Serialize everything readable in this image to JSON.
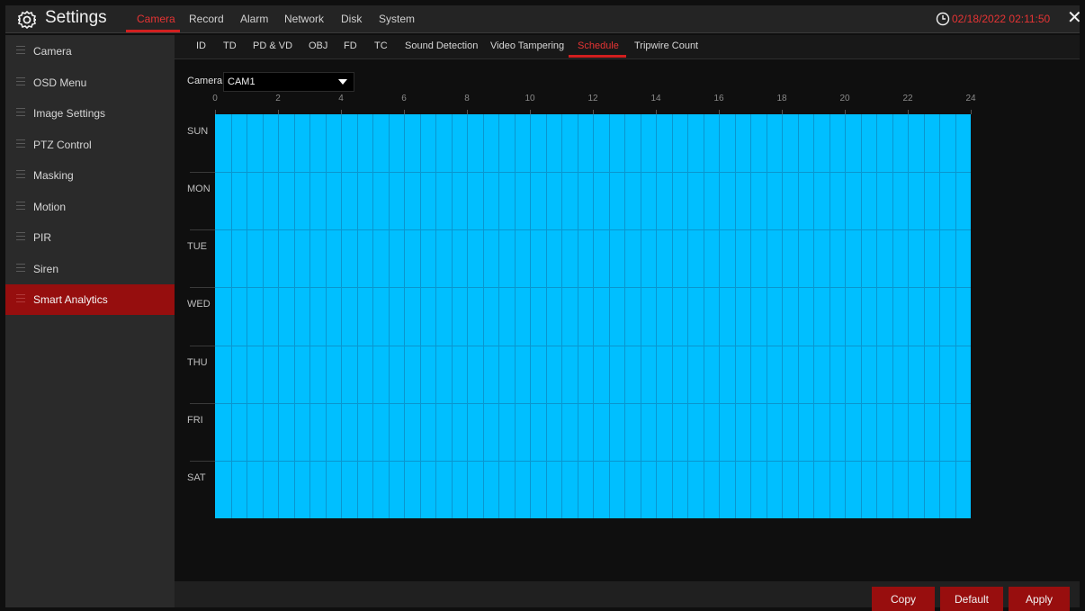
{
  "header": {
    "title": "Settings",
    "icon": "gear-icon",
    "datetime": "02/18/2022 02:11:50",
    "accent_color": "#d21f1f",
    "tabs": [
      {
        "label": "Camera",
        "active": true
      },
      {
        "label": "Record"
      },
      {
        "label": "Alarm"
      },
      {
        "label": "Network"
      },
      {
        "label": "Disk"
      },
      {
        "label": "System"
      }
    ]
  },
  "sidebar": {
    "items": [
      {
        "label": "Camera"
      },
      {
        "label": "OSD Menu"
      },
      {
        "label": "Image Settings"
      },
      {
        "label": "PTZ Control"
      },
      {
        "label": "Masking"
      },
      {
        "label": "Motion"
      },
      {
        "label": "PIR"
      },
      {
        "label": "Siren"
      },
      {
        "label": "Smart Analytics",
        "active": true
      }
    ]
  },
  "subtabs": [
    {
      "label": "ID"
    },
    {
      "label": "TD"
    },
    {
      "label": "PD & VD"
    },
    {
      "label": "OBJ"
    },
    {
      "label": "FD"
    },
    {
      "label": "TC"
    },
    {
      "label": "Sound Detection"
    },
    {
      "label": "Video Tampering"
    },
    {
      "label": "Schedule",
      "active": true
    },
    {
      "label": "Tripwire Count"
    }
  ],
  "camera": {
    "label": "Camera",
    "value": "CAM1"
  },
  "schedule": {
    "hour_labels": [
      "0",
      "2",
      "4",
      "6",
      "8",
      "10",
      "12",
      "14",
      "16",
      "18",
      "20",
      "22",
      "24"
    ],
    "days": [
      "SUN",
      "MON",
      "TUE",
      "WED",
      "THU",
      "FRI",
      "SAT"
    ],
    "fill_color": "#00bfff",
    "all_slots_selected": true
  },
  "buttons": {
    "copy": "Copy",
    "default": "Default",
    "apply": "Apply"
  }
}
